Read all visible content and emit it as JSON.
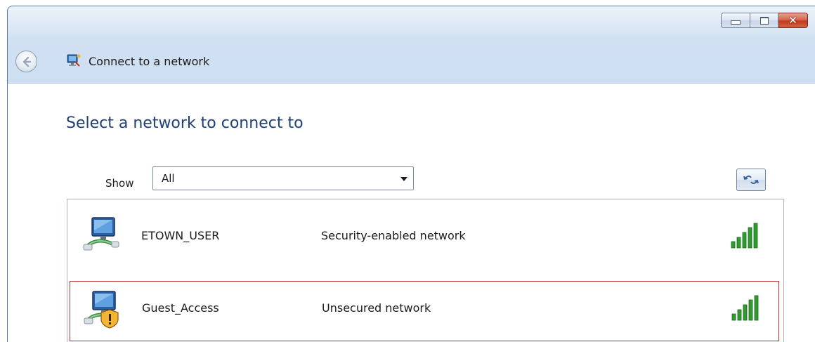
{
  "window": {
    "title": "Connect to a network",
    "caption_buttons": {
      "minimize_icon": "minimize-icon",
      "maximize_icon": "maximize-icon",
      "close_glyph": "✕"
    }
  },
  "main": {
    "heading": "Select a network to connect to",
    "show_label": "Show",
    "show_selected": "All",
    "refresh_icon": "refresh-icon",
    "networks": [
      {
        "name": "ETOWN_USER",
        "security": "Security-enabled network",
        "icon": "secured-network-icon",
        "signal_bars": 5
      },
      {
        "name": "Guest_Access",
        "security": "Unsecured network",
        "icon": "unsecured-network-icon",
        "signal_bars": 5
      }
    ]
  },
  "colors": {
    "heading": "#1e3f7a",
    "selected_border": "#c0302b",
    "signal_green": "#2e9c2e",
    "titlebar": "#c7dbef"
  }
}
